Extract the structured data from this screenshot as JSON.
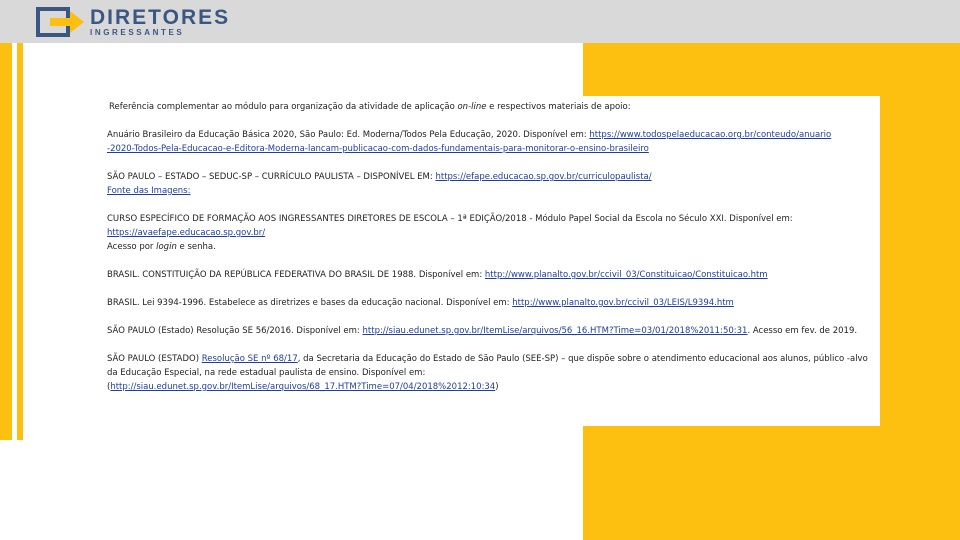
{
  "header": {
    "logo_main": "DIRETORES",
    "logo_sub": "INGRESSANTES"
  },
  "colors": {
    "accent_yellow": "#fec010",
    "header_gray": "#d9d9d9",
    "logo_blue": "#3a5784",
    "link_blue": "#1f3ea0"
  },
  "intro": {
    "pre": "Referência complementar ao módulo para organização da atividade de aplicação ",
    "italic": "on-line",
    "post": " e respectivos materiais de apoio:"
  },
  "refs": {
    "r1_text": "Anuário Brasileiro da Educação Básica 2020, São Paulo: Ed. Moderna/Todos Pela Educação, 2020. Disponível em: ",
    "r1_link_a": "https://www.todospelaeducacao.org.br/conteudo/anuario",
    "r1_link_b": "-2020-Todos-Pela-Educacao-e-Editora-Moderna-lancam-publicacao-com-dados-fundamentais-para-monitorar-o-ensino-brasileiro",
    "r2_text": "SÃO PAULO – ESTADO – SEDUC-SP – CURRÍCULO PAULISTA – DISPONÍVEL EM: ",
    "r2_link": "https://efape.educacao.sp.gov.br/curriculopaulista/",
    "r2_line2": "Fonte das Imagens:",
    "r3_text": "CURSO ESPECÍFICO DE FORMAÇÃO AOS INGRESSANTES DIRETORES DE ESCOLA – 1ª EDIÇÃO/2018 - Módulo Papel Social da Escola no Século XXI. Disponível em:",
    "r3_link": "https://avaefape.educacao.sp.gov.br/",
    "r3_access_pre": "Acesso por ",
    "r3_access_italic": "login",
    "r3_access_post": " e senha.",
    "r4_text": "BRASIL. CONSTITUIÇÃO DA REPÚBLICA FEDERATIVA DO BRASIL DE 1988. Disponível em: ",
    "r4_link": "http://www.planalto.gov.br/ccivil_03/Constituicao/Constituicao.htm",
    "r5_text": "BRASIL. Lei 9394-1996. Estabelece as diretrizes e bases da educação nacional. Disponível em: ",
    "r5_link": "http://www.planalto.gov.br/ccivil_03/LEIS/L9394.htm",
    "r6_text": "SÃO PAULO (Estado) Resolução SE 56/2016. Disponível em: ",
    "r6_link": "http://siau.edunet.sp.gov.br/ItemLise/arquivos/56_16.HTM?Time=03/01/2018%2011:50:31",
    "r6_post": ". Acesso em fev. de 2019.",
    "r7_pre": "SÃO PAULO (ESTADO) ",
    "r7_link1": "Resolução SE nº 68/17",
    "r7_mid": ", da Secretaria da Educação do Estado de São Paulo (SEE-SP) – que dispõe sobre o atendimento educacional aos alunos, público -alvo da Educação Especial, na rede estadual paulista de ensino. Disponível em:",
    "r7_paren_open": "(",
    "r7_link2": "http://siau.edunet.sp.gov.br/ItemLise/arquivos/68_17.HTM?Time=07/04/2018%2012:10:34",
    "r7_paren_close": ")"
  }
}
